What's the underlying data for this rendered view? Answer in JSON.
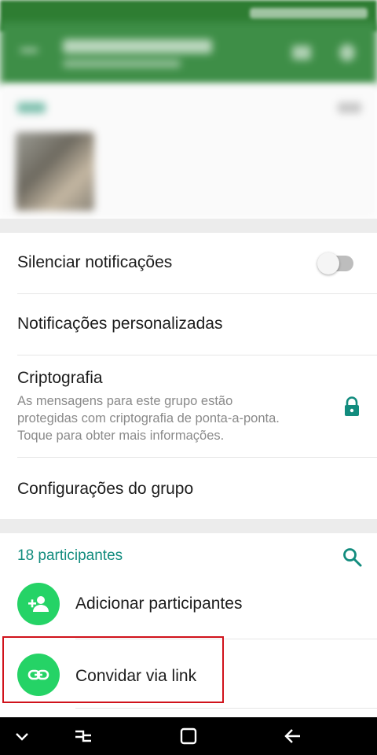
{
  "statusbar": {
    "icons": [
      "wifi-icon",
      "signal-icon",
      "battery-icon"
    ]
  },
  "appbar": {
    "icons": [
      "back-arrow-icon",
      "edit-pencil-icon",
      "more-vert-icon"
    ]
  },
  "settings": {
    "mute": {
      "label": "Silenciar notificações",
      "enabled": false
    },
    "custom_notifications": {
      "label": "Notificações personalizadas"
    },
    "encryption": {
      "title": "Criptografia",
      "description_lines": [
        "As mensagens para este grupo estão",
        "protegidas com criptografia de ponta-a-ponta.",
        "Toque para obter mais informações."
      ],
      "icon": "lock-icon"
    },
    "group_settings": {
      "label": "Configurações do grupo"
    }
  },
  "participants": {
    "title": "18 participantes",
    "search_icon": "search-icon",
    "actions": [
      {
        "label": "Adicionar participantes",
        "icon": "add-person-icon"
      },
      {
        "label": "Convidar via link",
        "icon": "link-icon"
      }
    ]
  },
  "navbar": {
    "icons": [
      "nav-hide-icon",
      "recents-icon",
      "home-icon",
      "back-icon"
    ]
  },
  "colors": {
    "header_green": "#3e8e47",
    "accent_teal": "#128c7e",
    "avatar_green": "#25d366",
    "highlight_red": "#d0121b",
    "lock_teal": "#128c7e"
  }
}
